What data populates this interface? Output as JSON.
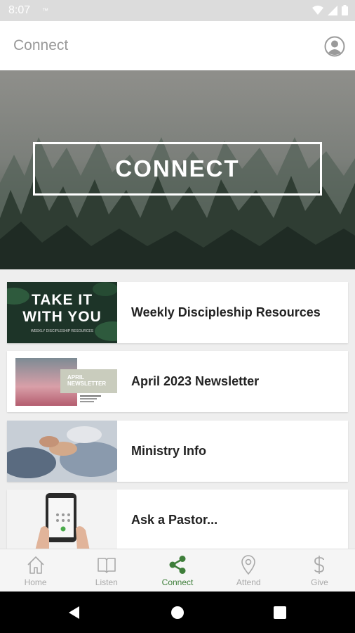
{
  "status_bar": {
    "time": "8:07",
    "small_text": "™"
  },
  "app_bar": {
    "title": "Connect",
    "avatar_icon": "account-circle-icon"
  },
  "hero": {
    "text": "CONNECT"
  },
  "cards": [
    {
      "label": "Weekly Discipleship Resources",
      "thumb_title_line1": "TAKE IT",
      "thumb_title_line2": "WITH YOU",
      "thumb_subtitle": "WEEKLY DISCIPLESHIP RESOURCES"
    },
    {
      "label": "April 2023 Newsletter",
      "thumb_title_line1": "APRIL",
      "thumb_title_line2": "NEWSLETTER"
    },
    {
      "label": "Ministry Info"
    },
    {
      "label": "Ask a Pastor..."
    }
  ],
  "tabs": [
    {
      "label": "Home",
      "icon": "home-icon",
      "active": false
    },
    {
      "label": "Listen",
      "icon": "book-icon",
      "active": false
    },
    {
      "label": "Connect",
      "icon": "share-icon",
      "active": true
    },
    {
      "label": "Attend",
      "icon": "location-pin-icon",
      "active": false
    },
    {
      "label": "Give",
      "icon": "dollar-icon",
      "active": false
    }
  ],
  "colors": {
    "accent": "#3e7e3a",
    "inactive": "#a9a9a9"
  }
}
